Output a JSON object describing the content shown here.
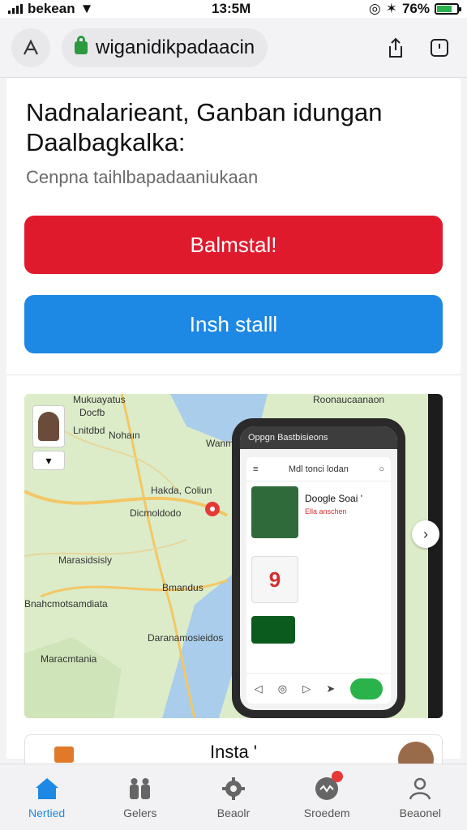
{
  "status_bar": {
    "carrier": "bekean",
    "time": "13:5M",
    "battery": "76%",
    "battery_level": 0.76
  },
  "browser": {
    "url": "wiganidikpadaacin",
    "left_icon": "tab-switcher-icon",
    "share_icon": "share-icon",
    "tabs_icon": "tabs-icon"
  },
  "page": {
    "headline": "Nadnalarieant, Ganban idungan Daalbagkalka:",
    "subline": "Cenpna taihlbapadaaniukaan",
    "primary_button": "Balmstal!",
    "secondary_button": "Insh stalll"
  },
  "map": {
    "labels": [
      "Mukuayatus",
      "Docfb",
      "Lnitdbd",
      "Nohaın",
      "Wanm",
      "Hakda, Coliun",
      "Dicmoldodo",
      "Marasidsisly",
      "Bmandus",
      "Bnahcmotsamdiata",
      "Maracmtania",
      "Daranamosieidos",
      "Roonaucaanaon"
    ]
  },
  "phone_mock": {
    "top_bar": "Oppgn Bastbisieons",
    "app_title": "Mdl tonci lodan",
    "item_title": "Doogle Soai '",
    "item_sub": "Ella anschen",
    "item_number": "9",
    "bottom_label": "..."
  },
  "bottom_card": {
    "title": "Insta '"
  },
  "tab_bar": {
    "items": [
      {
        "label": "Nertied",
        "icon": "home-icon",
        "active": true
      },
      {
        "label": "Gelers",
        "icon": "people-icon",
        "active": false
      },
      {
        "label": "Beaolr",
        "icon": "settings-icon",
        "active": false
      },
      {
        "label": "Sroedem",
        "icon": "chat-icon",
        "active": false
      },
      {
        "label": "Beaonel",
        "icon": "profile-icon",
        "active": false
      }
    ]
  },
  "colors": {
    "primary_red": "#e01a2d",
    "primary_blue": "#1e88e5",
    "active_tab": "#1e88e5"
  }
}
